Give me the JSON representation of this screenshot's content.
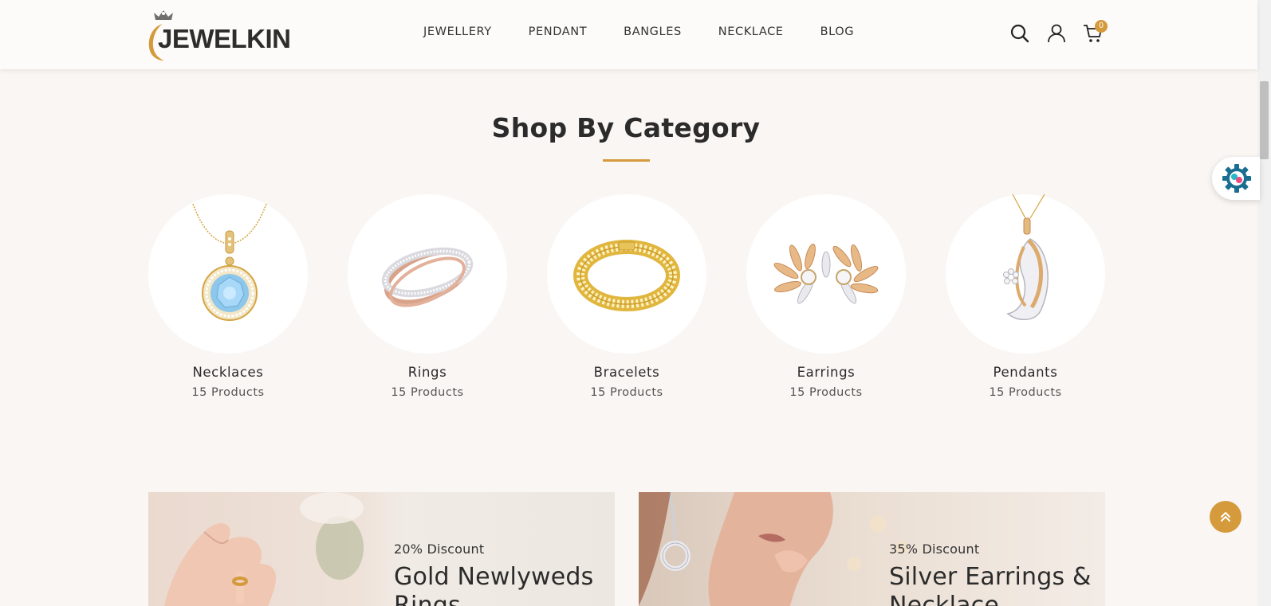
{
  "brand": {
    "name": "JEWELKIN"
  },
  "nav": {
    "items": [
      "JEWELLERY",
      "PENDANT",
      "BANGLES",
      "NECKLACE",
      "BLOG"
    ]
  },
  "header_icons": {
    "search": "search-icon",
    "account": "user-icon",
    "cart": "cart-icon",
    "cart_count": "0"
  },
  "category_section": {
    "title": "Shop By Category",
    "items": [
      {
        "name": "Necklaces",
        "count": "15 Products",
        "icon": "necklace-image"
      },
      {
        "name": "Rings",
        "count": "15 Products",
        "icon": "ring-image"
      },
      {
        "name": "Bracelets",
        "count": "15 Products",
        "icon": "bracelet-image"
      },
      {
        "name": "Earrings",
        "count": "15 Products",
        "icon": "earrings-image"
      },
      {
        "name": "Pendants",
        "count": "15 Products",
        "icon": "pendant-image"
      }
    ]
  },
  "banners": [
    {
      "discount": "20% Discount",
      "title": "Gold Newlyweds Rings"
    },
    {
      "discount": "35% Discount",
      "title": "Silver Earrings & Necklace"
    }
  ],
  "colors": {
    "accent": "#d49a3b",
    "background": "#faf6f3",
    "text": "#2b2b2b"
  }
}
